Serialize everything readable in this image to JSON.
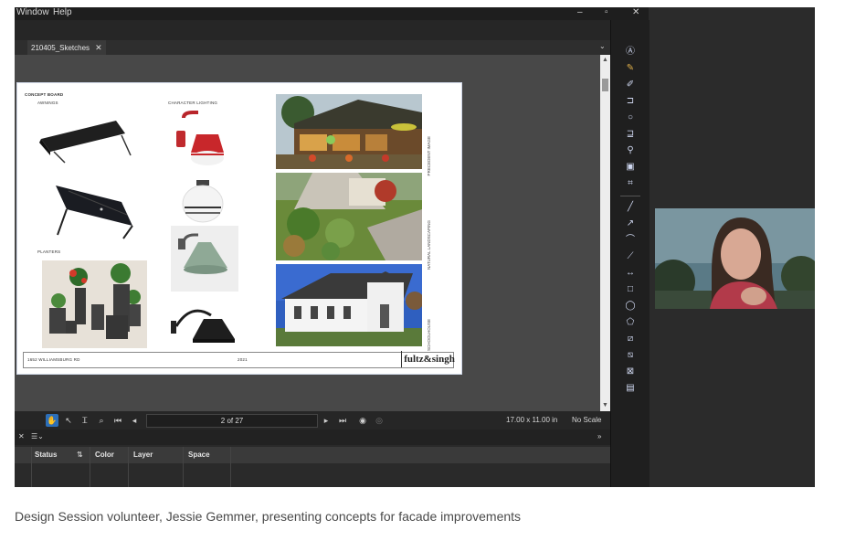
{
  "menu": {
    "window": "Window",
    "help": "Help"
  },
  "tab": {
    "label": "210405_Sketches"
  },
  "board": {
    "title": "CONCEPT BOARD",
    "awnings": "AWNINGS",
    "character_lighting": "CHARACTER LIGHTING",
    "planters": "PLANTERS",
    "photo1_label": "PRECEDENT IMAGE",
    "photo2_label": "NATURAL LANDSCAPING",
    "photo3_label": "SCHOOLHOUSE",
    "address": "1652 WILLIAMSBURG RD",
    "year": "2021",
    "logo_text": "fultz&singh"
  },
  "status_bar": {
    "page_display": "2 of 27",
    "page_size": "17.00 x 11.00 in",
    "scale": "No Scale"
  },
  "markups_panel": {
    "columns": [
      "Status",
      "Color",
      "Layer",
      "Space"
    ]
  },
  "caption": "Design Session volunteer, Jessie Gemmer, presenting concepts for facade improvements"
}
